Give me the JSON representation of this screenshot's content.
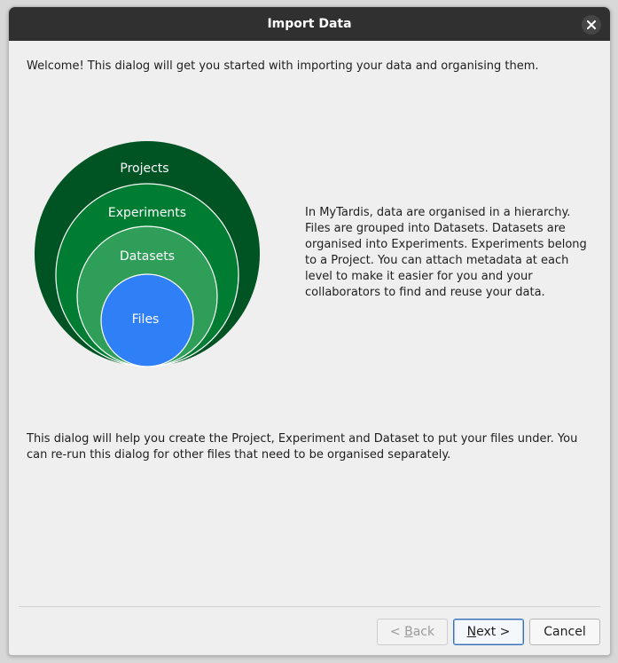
{
  "window": {
    "title": "Import Data",
    "close_icon": "close-icon"
  },
  "intro": {
    "welcome": "Welcome! This dialog will get you started with importing your data and organising them.",
    "explanation": "In MyTardis, data are organised in a hierarchy. Files are grouped into Datasets. Datasets are organised into Experiments. Experiments belong to a Project. You can attach metadata at each level to make it easier for you and your collaborators to find and reuse your data.",
    "help": "This dialog will help you create the Project, Experiment and Dataset to put your files under. You can re-run this dialog for other files that need to be organised separately."
  },
  "hierarchy": {
    "levels": [
      "Projects",
      "Experiments",
      "Datasets",
      "Files"
    ],
    "colors": [
      "#005322",
      "#007d32",
      "#2e9e59",
      "#2f7ff6"
    ]
  },
  "buttons": {
    "back_mnemonic": "B",
    "back_rest": "ack",
    "back_prefix": "< ",
    "next_mnemonic": "N",
    "next_rest": "ext >",
    "cancel": "Cancel"
  }
}
